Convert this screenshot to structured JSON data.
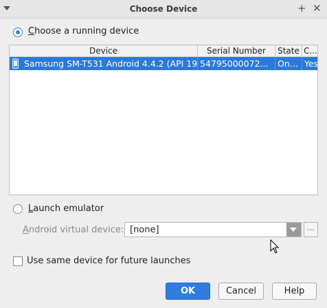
{
  "window": {
    "title": "Choose Device"
  },
  "running": {
    "option_label": "Choose a running device",
    "option_hotkey": "C",
    "option_rest": "hoose a running device",
    "columns": [
      "Device",
      "Serial Number",
      "State",
      "C..."
    ],
    "rows": [
      {
        "device": "Samsung SM-T531 Android 4.4.2 (API 19",
        "serial": "54795000072...",
        "state": "On...",
        "compat": "Yes"
      }
    ]
  },
  "emulator": {
    "option_hotkey": "L",
    "option_rest": "aunch emulator",
    "avd_hotkey": "A",
    "avd_rest": "ndroid virtual device:",
    "avd_value": "[none]",
    "browse_label": "..."
  },
  "same_device": {
    "label": "Use same device for future launches"
  },
  "buttons": {
    "ok": "OK",
    "cancel": "Cancel",
    "help": "Help"
  },
  "colors": {
    "accent": "#2b79d8",
    "primary_button": "#2f7de1"
  }
}
